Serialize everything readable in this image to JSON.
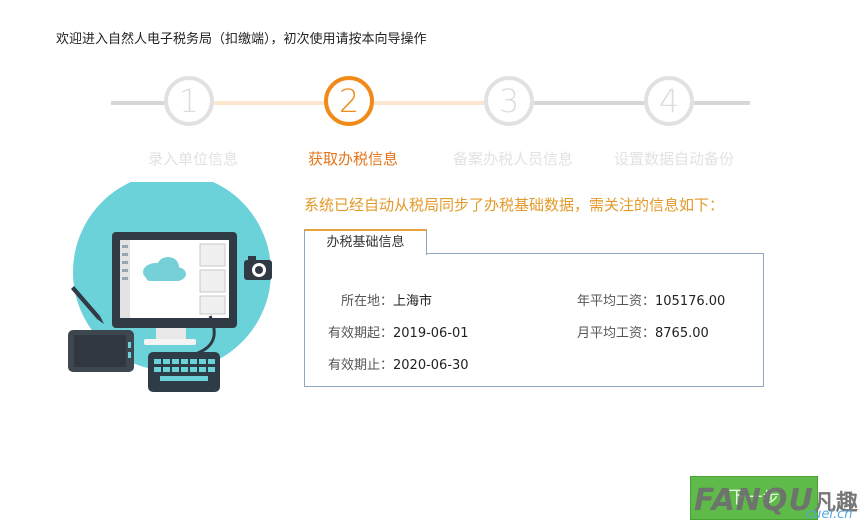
{
  "welcome_text": "欢迎进入自然人电子税务局（扣缴端），初次使用请按本向导操作",
  "steps": [
    {
      "number": "1",
      "label": "录入单位信息",
      "state": "done"
    },
    {
      "number": "2",
      "label": "获取办税信息",
      "state": "active"
    },
    {
      "number": "3",
      "label": "备案办税人员信息",
      "state": "pending"
    },
    {
      "number": "4",
      "label": "设置数据自动备份",
      "state": "pending"
    }
  ],
  "sync_message": "系统已经自动从税局同步了办税基础数据，需关注的信息如下：",
  "panel": {
    "tab_label": "办税基础信息",
    "location_label": "所在地：",
    "location_value": "上海市",
    "valid_from_label": "有效期起：",
    "valid_from_value": "2019-06-01",
    "valid_to_label": "有效期止：",
    "valid_to_value": "2020-06-30",
    "annual_salary_label": "年平均工资：",
    "annual_salary_value": "105176.00",
    "monthly_salary_label": "月平均工资：",
    "monthly_salary_value": "8765.00"
  },
  "next_button_label": "下一步",
  "watermark": {
    "brand": "FANQU",
    "brand_cn": "凡趣",
    "domain": "cuel.cn"
  },
  "colors": {
    "active_orange": "#f08a18",
    "inactive_gray": "#e1e1e1",
    "done_track": "#fde6cf",
    "message_orange": "#e39a2a",
    "panel_border": "#8fa6c2",
    "button_green": "#5fbb49",
    "illustration_circle": "#6bd2d9"
  },
  "icons": [
    "monitor-icon",
    "cloud-icon",
    "keyboard-icon",
    "tablet-icon",
    "pen-icon",
    "camera-icon"
  ]
}
